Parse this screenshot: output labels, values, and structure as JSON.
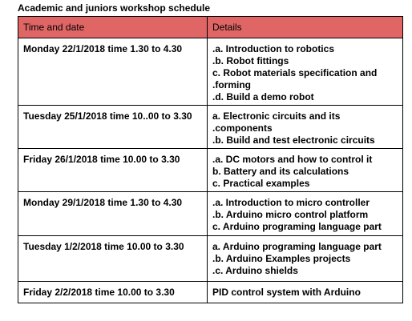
{
  "title": "Academic and juniors workshop schedule",
  "table": {
    "headers": [
      "Time and date",
      "Details"
    ],
    "rows": [
      {
        "time": "Monday 22/1/2018  time 1.30 to 4.30",
        "details": [
          ".a. Introduction to robotics",
          ".b. Robot fittings",
          "c. Robot materials specification and",
          ".forming",
          ".d. Build a demo robot"
        ]
      },
      {
        "time": "Tuesday  25/1/2018 time 10..00 to 3.30",
        "details": [
          "a. Electronic circuits and its",
          ".components",
          ".b. Build and test electronic circuits"
        ]
      },
      {
        "time": "Friday 26/1/2018 time 10.00 to 3.30",
        "details": [
          ".a. DC motors and how to control it",
          "b. Battery and its calculations",
          "c. Practical examples"
        ]
      },
      {
        "time": "Monday 29/1/2018 time 1.30 to 4.30",
        "details": [
          ".a. Introduction to micro controller",
          ".b. Arduino micro control platform",
          "c. Arduino programing language part"
        ]
      },
      {
        "time": "Tuesday 1/2/2018 time 10.00 to 3.30",
        "details": [
          "a. Arduino programing language part",
          ".b. Arduino Examples projects",
          ".c. Arduino shields"
        ]
      },
      {
        "time": "Friday 2/2/2018 time 10.00 to 3.30",
        "details": [
          "PID control system with Arduino"
        ]
      }
    ]
  },
  "colors": {
    "header_background": "#e06666",
    "border": "#000000"
  }
}
